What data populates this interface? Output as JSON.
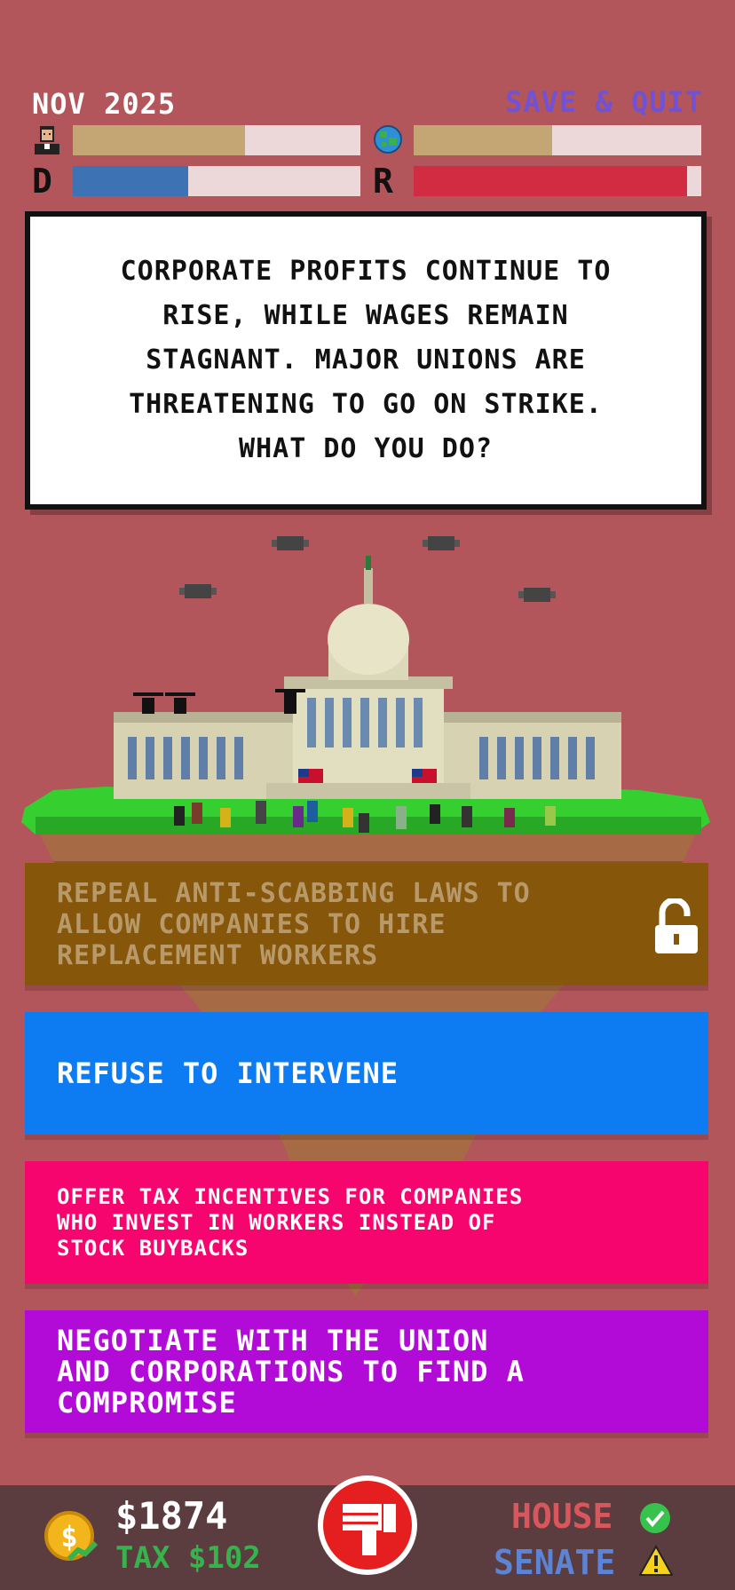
{
  "header": {
    "date": "NOV 2025",
    "save_quit": "SAVE & QUIT"
  },
  "meters": {
    "approval": {
      "icon": "voter-face-icon",
      "fill_fraction": 0.6,
      "color": "#c4a574"
    },
    "world": {
      "icon": "globe-icon",
      "fill_fraction": 0.5,
      "color": "#c4a574"
    },
    "democrats": {
      "letter": "D",
      "fill_fraction": 0.4,
      "color": "#3d72b4"
    },
    "republicans": {
      "letter": "R",
      "fill_fraction": 0.95,
      "color": "#d12c41"
    }
  },
  "event": {
    "text": "CORPORATE PROFITS CONTINUE TO RISE, WHILE WAGES REMAIN STAGNANT. MAJOR UNIONS ARE THREATENING TO GO ON STRIKE. WHAT DO YOU DO?"
  },
  "choices": [
    {
      "text": "REPEAL ANTI-SCABBING LAWS TO ALLOW COMPANIES TO HIRE REPLACEMENT WORKERS",
      "locked_icon": "unlocked-padlock-icon",
      "color": "#86560a"
    },
    {
      "text": "REFUSE TO INTERVENE",
      "color": "#0d7cf2"
    },
    {
      "text": "OFFER TAX INCENTIVES FOR COMPANIES WHO INVEST IN WORKERS INSTEAD OF STOCK BUYBACKS",
      "color": "#f7056f"
    },
    {
      "text": "NEGOTIATE WITH THE UNION AND CORPORATIONS TO FIND A COMPROMISE",
      "color": "#b20bd8"
    }
  ],
  "footer": {
    "money": "$1874",
    "tax": "TAX $102",
    "house": "HOUSE",
    "senate": "SENATE",
    "house_status_icon": "check-icon",
    "senate_status_icon": "warning-icon"
  }
}
